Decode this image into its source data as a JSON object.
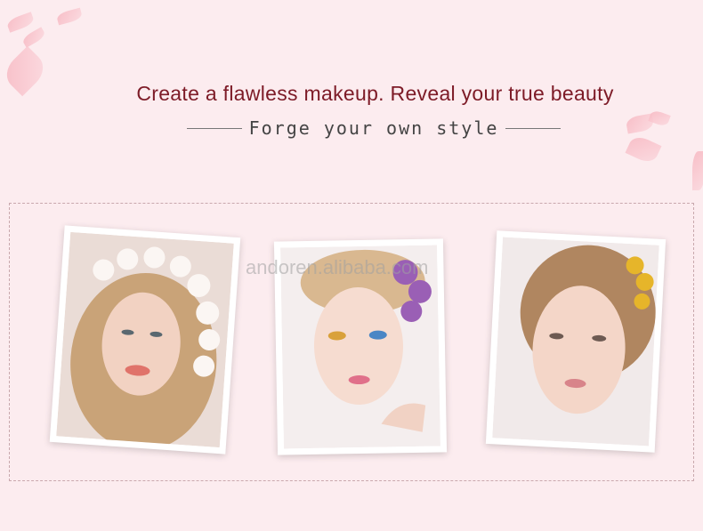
{
  "headline": "Create a flawless makeup. Reveal your true beauty",
  "subheadline": "Forge your own style",
  "watermark": "andoren.alibaba.com",
  "colors": {
    "background": "#fcecef",
    "headline": "#7d1b27",
    "subheadline": "#444444",
    "petal": "#f7b6c0"
  },
  "photos": [
    {
      "subject": "woman with wavy blonde hair and white flower crown"
    },
    {
      "subject": "woman with colorful eye makeup and purple flowers"
    },
    {
      "subject": "woman with natural makeup and yellow flower in hair"
    }
  ]
}
